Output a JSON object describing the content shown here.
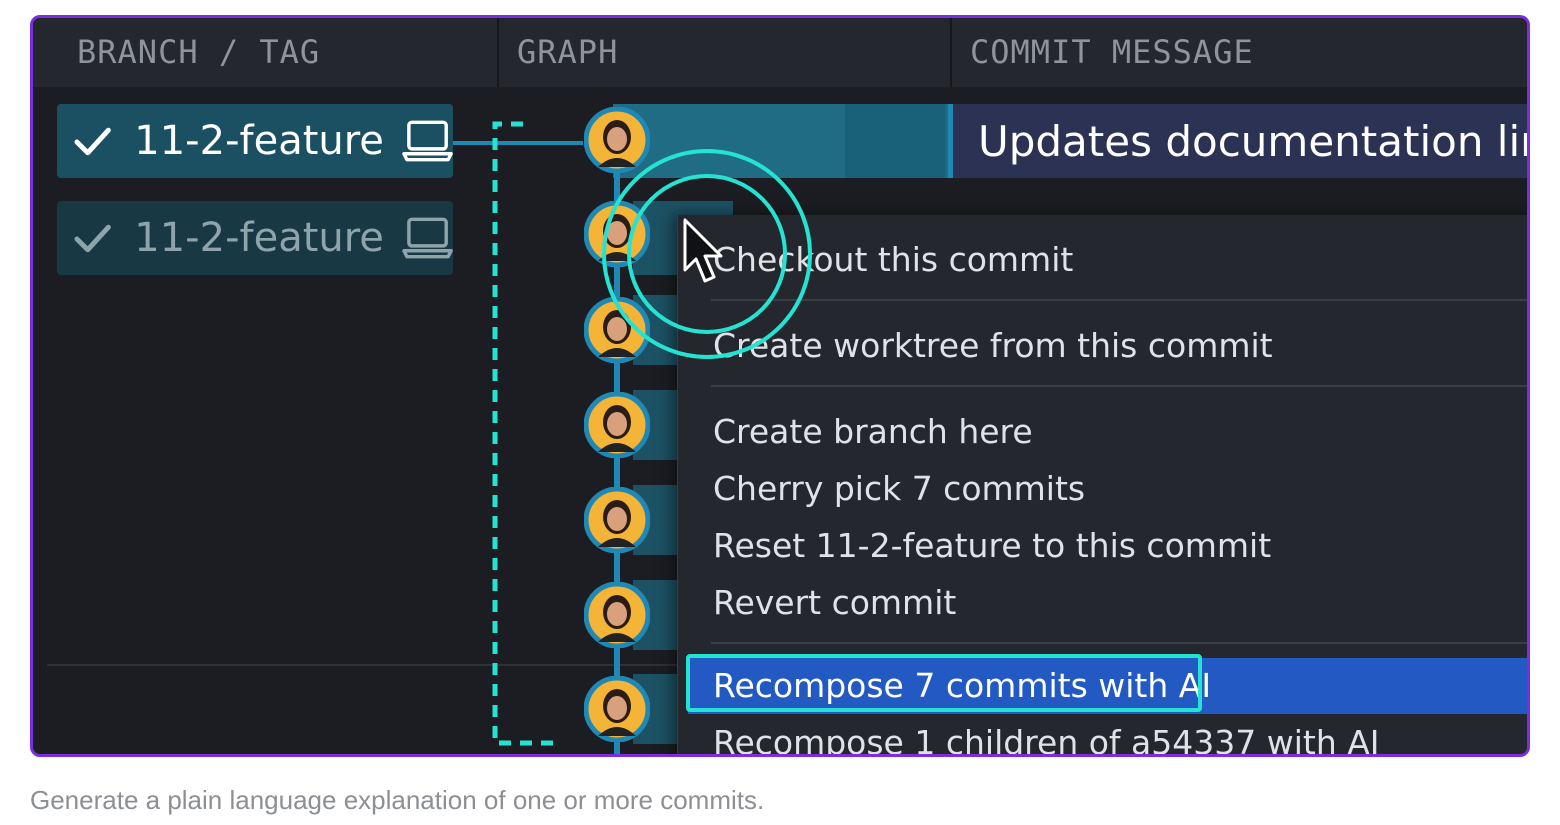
{
  "columns": {
    "branch_tag": "BRANCH / TAG",
    "graph": "GRAPH",
    "commit_message": "COMMIT MESSAGE"
  },
  "branches": [
    {
      "label": "11-2-feature",
      "state": "active",
      "icons": [
        "check-icon",
        "laptop-icon"
      ]
    },
    {
      "label": "11-2-feature",
      "state": "dimmed",
      "icons": [
        "check-icon",
        "laptop-icon"
      ]
    }
  ],
  "commit": {
    "message": "Updates documentation links"
  },
  "context_menu": {
    "items": [
      {
        "label": "Checkout this commit"
      },
      {
        "label": "Create worktree from this commit"
      },
      {
        "label": "Create branch here"
      },
      {
        "label": "Cherry pick 7 commits"
      },
      {
        "label": "Reset 11-2-feature to this commit"
      },
      {
        "label": "Revert commit"
      },
      {
        "label": "Recompose 7 commits with AI",
        "highlighted": true
      },
      {
        "label": "Recompose 1 children of a54337 with AI"
      }
    ]
  },
  "caption": "Generate a plain language explanation of one or more commits.",
  "colors": {
    "frame_border": "#7a2ee0",
    "accent_teal": "#25e3d2",
    "graph_line": "#1f88b4",
    "menu_active": "#2259c2",
    "branch_active": "#1b5062"
  }
}
